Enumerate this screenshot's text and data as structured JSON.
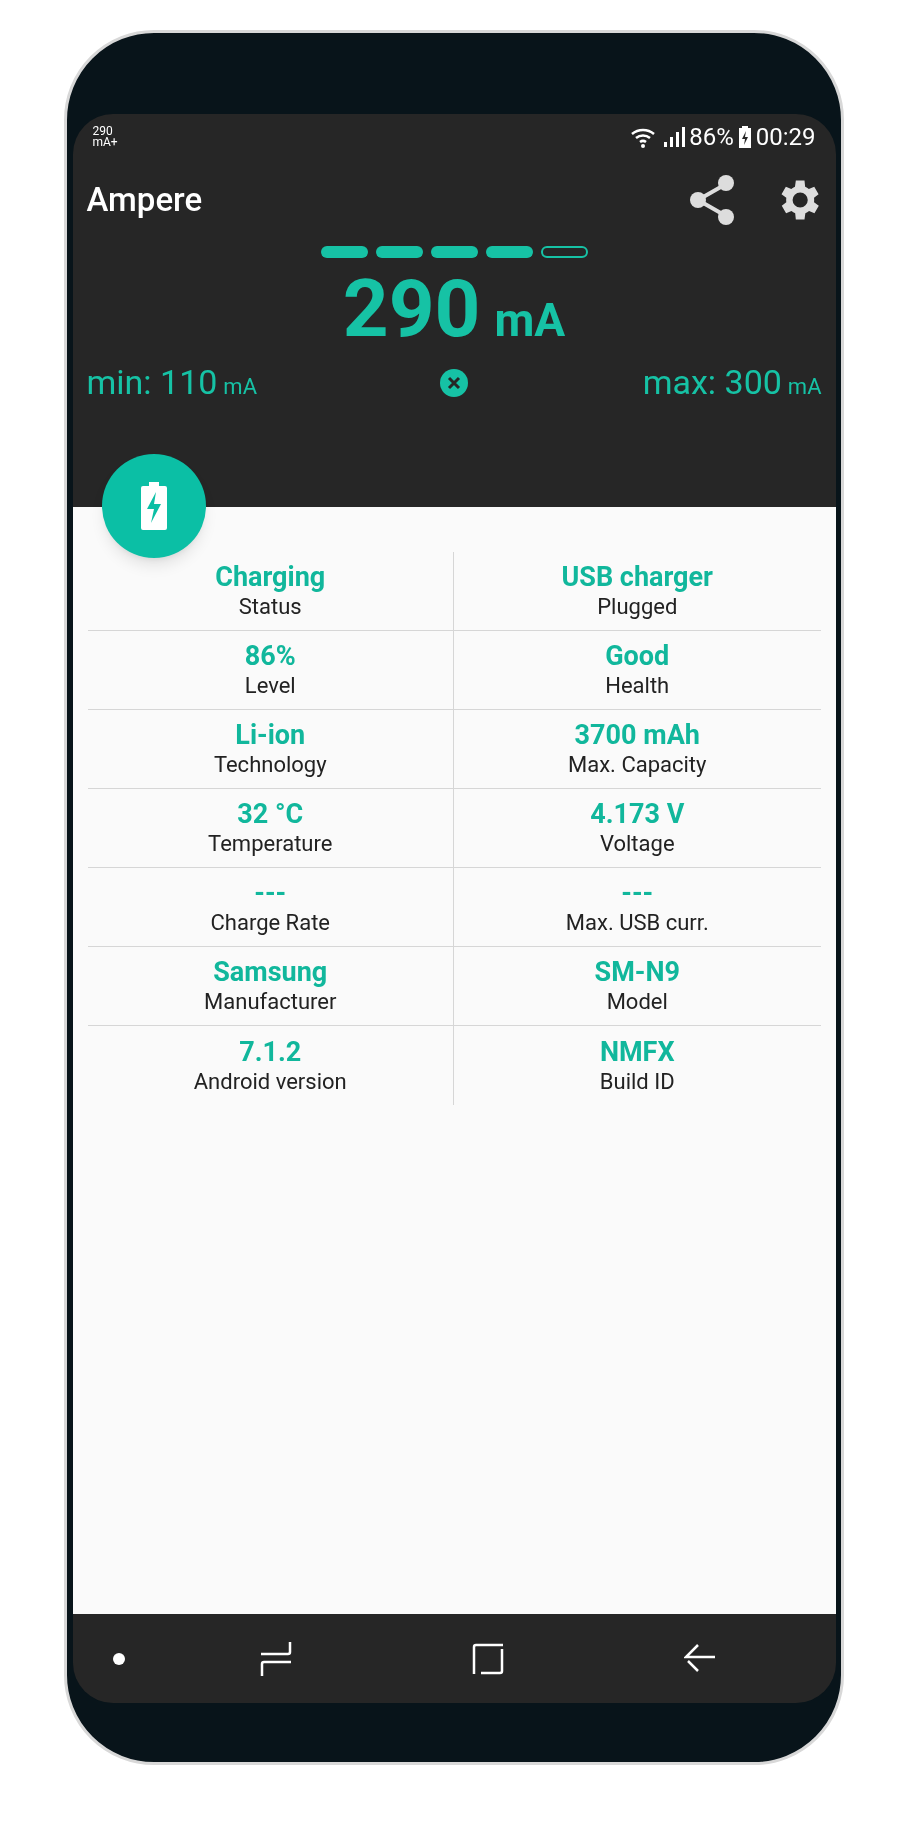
{
  "status_bar": {
    "notification": [
      "290",
      "mA+"
    ],
    "battery": "86%",
    "time": "00:29"
  },
  "app_bar": {
    "title": "Ampere"
  },
  "meter": {
    "level": 0.8
  },
  "current": {
    "value": "290",
    "unit": "mA"
  },
  "min": {
    "label": "min: 110",
    "unit": "mA"
  },
  "max": {
    "label": "max: 300",
    "unit": "mA"
  },
  "info": [
    {
      "value": "Charging",
      "label": "Status"
    },
    {
      "value": "USB charger",
      "label": "Plugged"
    },
    {
      "value": "86%",
      "label": "Level"
    },
    {
      "value": "Good",
      "label": "Health"
    },
    {
      "value": "Li-ion",
      "label": "Technology"
    },
    {
      "value": "3700 mAh",
      "label": "Max. Capacity"
    },
    {
      "value": "32 °C",
      "label": "Temperature"
    },
    {
      "value": "4.173 V",
      "label": "Voltage"
    },
    {
      "value": "---",
      "label": "Charge Rate"
    },
    {
      "value": "---",
      "label": "Max. USB curr."
    },
    {
      "value": "Samsung",
      "label": "Manufacturer"
    },
    {
      "value": "SM-N9",
      "label": "Model"
    },
    {
      "value": "7.1.2",
      "label": "Android version"
    },
    {
      "value": "NMFX",
      "label": "Build ID"
    }
  ]
}
